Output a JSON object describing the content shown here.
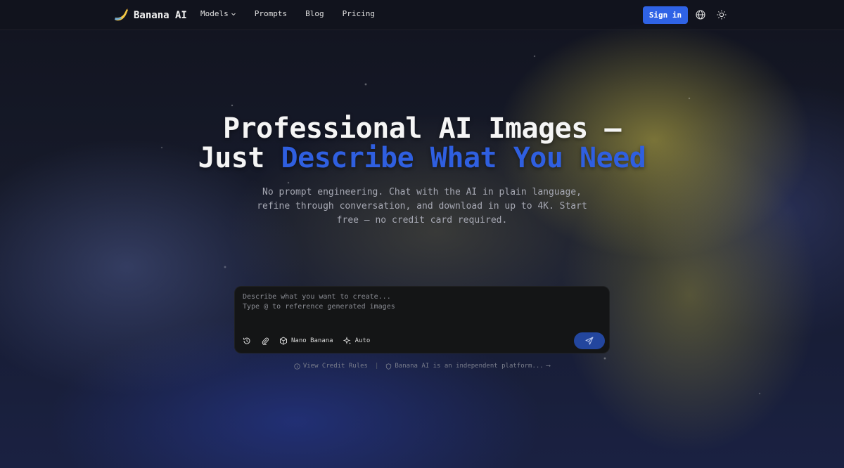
{
  "header": {
    "brand": "Banana AI",
    "nav": [
      {
        "label": "Models",
        "has_dropdown": true
      },
      {
        "label": "Prompts"
      },
      {
        "label": "Blog"
      },
      {
        "label": "Pricing"
      }
    ],
    "signin_label": "Sign in",
    "accent_color": "#2f63e6"
  },
  "hero": {
    "title_part1": "Professional AI Images — Just",
    "title_accent": "Describe What You Need",
    "subtitle": "No prompt engineering. Chat with the AI in plain language, refine through conversation, and download in up to 4K. Start free — no credit card required."
  },
  "prompt": {
    "placeholder": "Describe what you want to create...\nType @ to reference generated images",
    "value": "",
    "model_label": "Nano Banana",
    "mode_label": "Auto"
  },
  "footer": {
    "credit_rules": "View Credit Rules",
    "separator": "|",
    "disclaimer": "Banana AI is an independent platform...",
    "arrow": "⟶"
  }
}
